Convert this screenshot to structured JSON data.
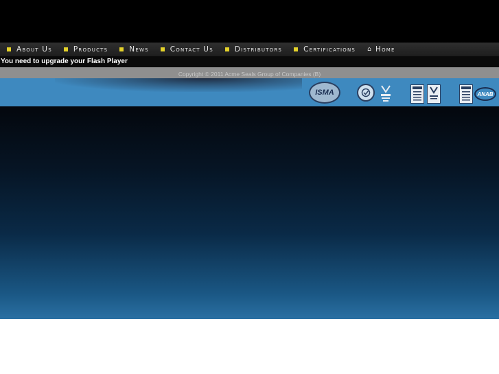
{
  "nav": {
    "items": [
      {
        "label": "About Us",
        "icon": "bullet"
      },
      {
        "label": "Products",
        "icon": "bullet"
      },
      {
        "label": "News",
        "icon": "bullet"
      },
      {
        "label": "Contact Us",
        "icon": "bullet"
      },
      {
        "label": "Distributors",
        "icon": "bullet"
      },
      {
        "label": "Certifications",
        "icon": "bullet"
      },
      {
        "label": "Home",
        "icon": "home-icon"
      }
    ]
  },
  "flash_notice": "You need to upgrade your Flash Player",
  "footer": {
    "copyright": "Copyright © 2011 Acme Seals Group of Companies (B)"
  },
  "certifications": {
    "isma": "ISMA",
    "anab": "ANAB"
  },
  "colors": {
    "accent": "#e4d22a",
    "strip": "#3e89bf"
  }
}
